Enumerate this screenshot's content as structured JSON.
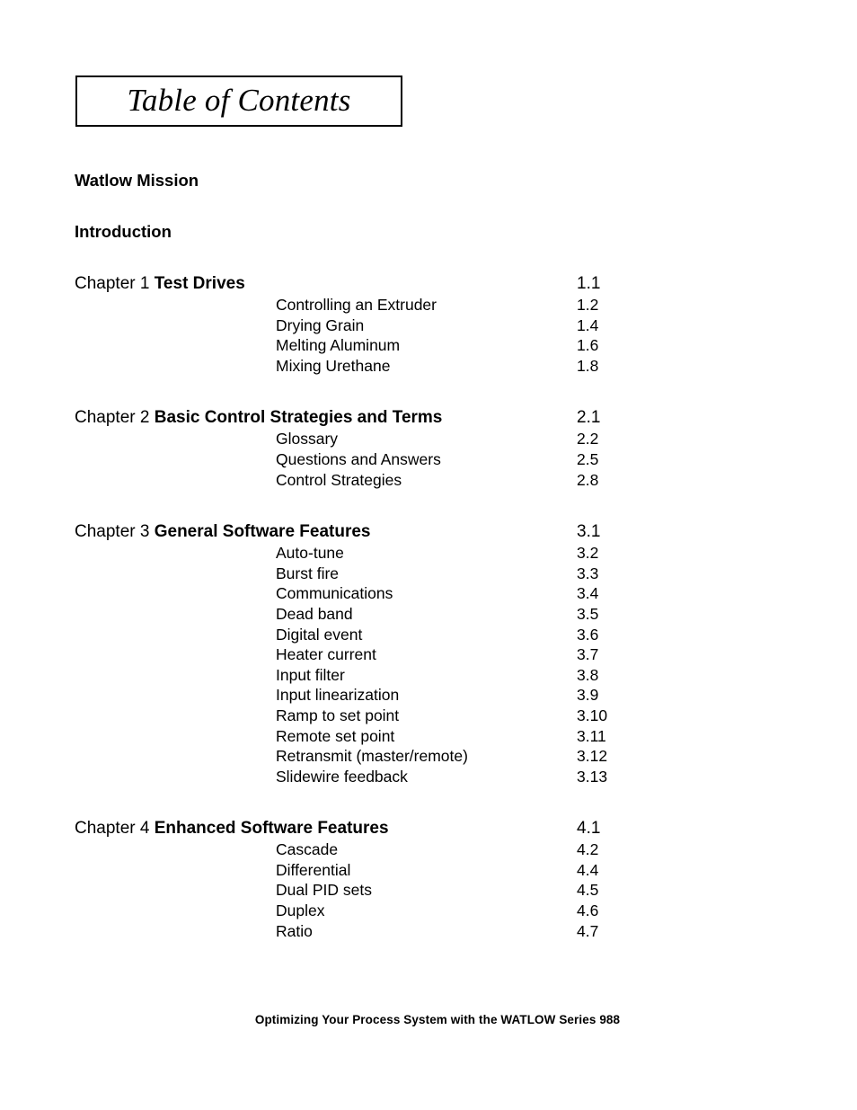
{
  "document": {
    "title": "Table of Contents",
    "footer": "Optimizing Your Process System with the WATLOW Series 988"
  },
  "front_sections": [
    {
      "label": "Watlow Mission"
    },
    {
      "label": "Introduction"
    }
  ],
  "chapters": [
    {
      "label": "Chapter 1",
      "title": "Test Drives",
      "page": "1.1",
      "entries": [
        {
          "title": "Controlling an Extruder",
          "page": "1.2"
        },
        {
          "title": "Drying Grain",
          "page": "1.4"
        },
        {
          "title": "Melting Aluminum",
          "page": "1.6"
        },
        {
          "title": "Mixing Urethane",
          "page": "1.8"
        }
      ]
    },
    {
      "label": "Chapter 2",
      "title": "Basic Control Strategies and Terms",
      "page": "2.1",
      "entries": [
        {
          "title": "Glossary",
          "page": "2.2"
        },
        {
          "title": "Questions and Answers",
          "page": "2.5"
        },
        {
          "title": "Control Strategies",
          "page": "2.8"
        }
      ]
    },
    {
      "label": "Chapter 3",
      "title": "General Software Features",
      "page": "3.1",
      "entries": [
        {
          "title": "Auto-tune",
          "page": "3.2"
        },
        {
          "title": "Burst fire",
          "page": "3.3"
        },
        {
          "title": "Communications",
          "page": "3.4"
        },
        {
          "title": "Dead band",
          "page": "3.5"
        },
        {
          "title": "Digital event",
          "page": "3.6"
        },
        {
          "title": "Heater current",
          "page": "3.7"
        },
        {
          "title": "Input filter",
          "page": "3.8"
        },
        {
          "title": "Input linearization",
          "page": "3.9"
        },
        {
          "title": "Ramp to set point",
          "page": "3.10"
        },
        {
          "title": "Remote set point",
          "page": "3.11"
        },
        {
          "title": "Retransmit (master/remote)",
          "page": "3.12"
        },
        {
          "title": "Slidewire feedback",
          "page": "3.13"
        }
      ]
    },
    {
      "label": "Chapter 4",
      "title": "Enhanced Software Features",
      "page": "4.1",
      "entries": [
        {
          "title": "Cascade",
          "page": "4.2"
        },
        {
          "title": "Differential",
          "page": "4.4"
        },
        {
          "title": "Dual PID sets",
          "page": "4.5"
        },
        {
          "title": "Duplex",
          "page": "4.6"
        },
        {
          "title": "Ratio",
          "page": "4.7"
        }
      ]
    }
  ]
}
